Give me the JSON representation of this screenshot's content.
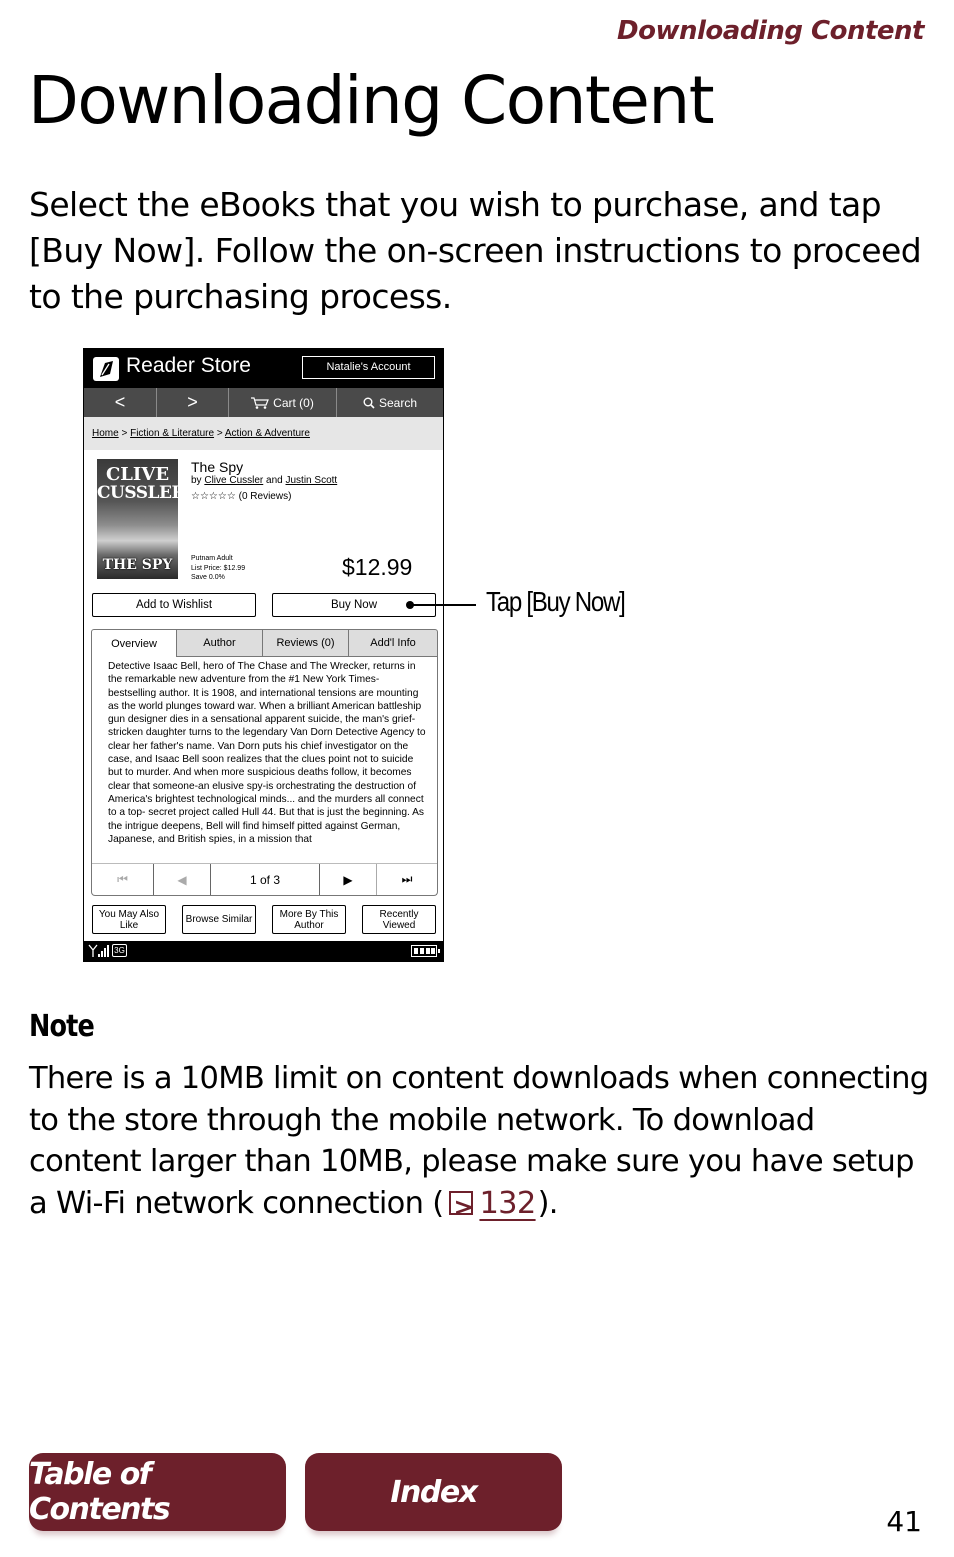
{
  "running_head": "Downloading Content",
  "page_title": "Downloading Content",
  "intro": "Select the eBooks that you wish to purchase, and tap [Buy Now]. Follow the on-screen instructions to proceed to the purchasing process.",
  "device": {
    "store_name": "Reader Store",
    "account_button": "Natalie's Account",
    "nav": {
      "back": "<",
      "forward": ">",
      "cart": "Cart (0)",
      "search": "Search"
    },
    "breadcrumb": [
      "Home",
      "Fiction & Literature",
      "Action & Adventure"
    ],
    "breadcrumb_separator": ">",
    "book": {
      "cover_line1": "CLIVE",
      "cover_line2": "CUSSLER",
      "cover_title": "THE SPY",
      "title": "The Spy",
      "by_prefix": "by",
      "author1": "Clive Cussler",
      "and": "and",
      "author2": "Justin Scott",
      "stars": "☆☆☆☆☆",
      "reviews": "(0 Reviews)",
      "publisher": "Putnam Adult",
      "list_price": "List Price: $12.99",
      "save": "Save 0.0%",
      "price": "$12.99"
    },
    "add_wishlist": "Add to Wishlist",
    "buy_now": "Buy Now",
    "tabs": [
      "Overview",
      "Author",
      "Reviews (0)",
      "Add'l Info"
    ],
    "overview": "Detective Isaac Bell, hero of The Chase and The Wrecker, returns in the remarkable new adventure from the #1 New York Times-bestselling author. It is 1908, and international tensions are mounting as the world plunges toward war. When a brilliant American battleship gun designer dies in a sensational apparent suicide, the man's grief-stricken daughter turns to the legendary Van Dorn Detective Agency to clear her father's name. Van Dorn puts his chief investigator on the case, and Isaac Bell soon realizes that the clues point not to suicide but to murder. And when more suspicious deaths follow, it becomes clear that someone-an elusive spy-is orchestrating the destruction of America's brightest technological minds... and the murders all connect to a top- secret project called Hull 44. But that is just the beginning. As the intrigue deepens, Bell will find himself pitted against German, Japanese, and British spies, in a mission that",
    "pager": {
      "first": "⏮",
      "prev": "◀",
      "info": "1 of 3",
      "next": "▶",
      "last": "⏭"
    },
    "bottom_buttons": [
      "You May Also Like",
      "Browse Similar",
      "More By This Author",
      "Recently Viewed"
    ],
    "network_badge": "3G"
  },
  "callout": "Tap [Buy Now]",
  "note": {
    "heading": "Note",
    "body": "There is a 10MB limit on content downloads when connecting to the store through the mobile network. To download content larger than 10MB, please make sure you have setup a Wi-Fi network connection (",
    "ref_page": "132",
    "body_end": ")."
  },
  "footer": {
    "toc_label": "Table of Contents",
    "index_label": "Index",
    "page_number": "41"
  },
  "colors": {
    "accent": "#6d202b"
  }
}
